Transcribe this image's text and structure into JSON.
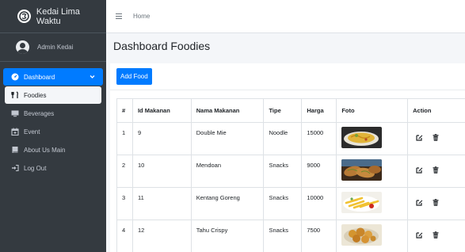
{
  "brand": {
    "name": "Kedai Lima Waktu"
  },
  "user": {
    "name": "Admin Kedai"
  },
  "sidebar": {
    "items": [
      {
        "label": "Dashboard",
        "icon": "dashboard-icon"
      },
      {
        "label": "Foodies",
        "icon": "utensils-icon"
      },
      {
        "label": "Beverages",
        "icon": "tv-icon"
      },
      {
        "label": "Event",
        "icon": "calendar-icon"
      },
      {
        "label": "About Us Main",
        "icon": "book-icon"
      },
      {
        "label": "Log Out",
        "icon": "sign-out-icon"
      }
    ]
  },
  "topbar": {
    "home": "Home"
  },
  "page": {
    "title": "Dashboard Foodies",
    "add_button": "Add Food"
  },
  "table": {
    "headers": [
      "#",
      "Id Makanan",
      "Nama Makanan",
      "Tipe",
      "Harga",
      "Foto",
      "Action"
    ],
    "rows": [
      {
        "no": "1",
        "id": "9",
        "nama": "Double Mie",
        "tipe": "Noodle",
        "harga": "15000"
      },
      {
        "no": "2",
        "id": "10",
        "nama": "Mendoan",
        "tipe": "Snacks",
        "harga": "9000"
      },
      {
        "no": "3",
        "id": "11",
        "nama": "Kentang Goreng",
        "tipe": "Snacks",
        "harga": "10000"
      },
      {
        "no": "4",
        "id": "12",
        "nama": "Tahu Crispy",
        "tipe": "Snacks",
        "harga": "7500"
      }
    ]
  },
  "colors": {
    "sidebar_bg": "#343a40",
    "accent": "#007bff",
    "topbar_bg": "#ffffff"
  }
}
